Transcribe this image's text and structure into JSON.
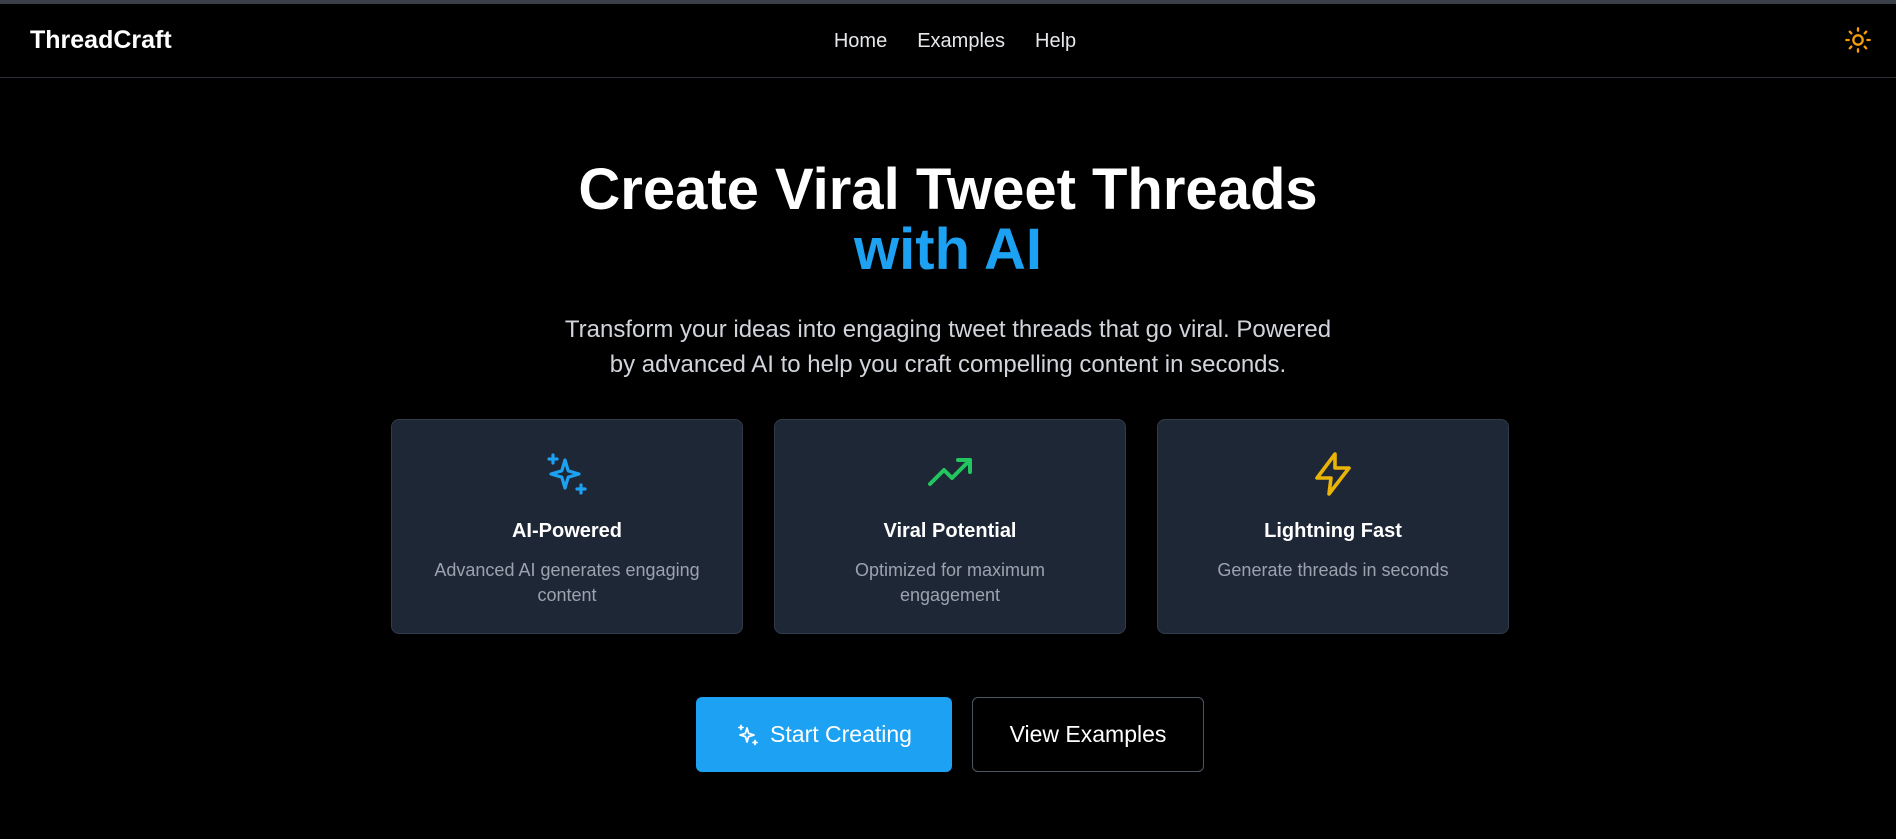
{
  "nav": {
    "brand": "ThreadCraft",
    "links": [
      "Home",
      "Examples",
      "Help"
    ],
    "theme_toggle_icon": "sun-icon"
  },
  "hero": {
    "title_line1": "Create Viral Tweet Threads",
    "title_line2": "with AI",
    "subtitle_line1": "Transform your ideas into engaging tweet threads that go viral. Powered",
    "subtitle_line2": "by advanced AI to help you craft compelling content in seconds."
  },
  "features": [
    {
      "icon": "sparkles-icon",
      "title": "AI-Powered",
      "desc_line1": "Advanced AI generates engaging",
      "desc_line2": "content",
      "color": "#1da1f2"
    },
    {
      "icon": "trending-up-icon",
      "title": "Viral Potential",
      "desc_line1": "Optimized for maximum engagement",
      "desc_line2": "",
      "color": "#22c55e"
    },
    {
      "icon": "lightning-icon",
      "title": "Lightning Fast",
      "desc_line1": "Generate threads in seconds",
      "desc_line2": "",
      "color": "#eab308"
    }
  ],
  "actions": {
    "primary_label": "Start Creating",
    "primary_icon": "sparkles-icon",
    "secondary_label": "View Examples"
  },
  "colors": {
    "accent": "#1da1f2",
    "card_bg": "#1e2736",
    "sun": "#f59e0b"
  }
}
